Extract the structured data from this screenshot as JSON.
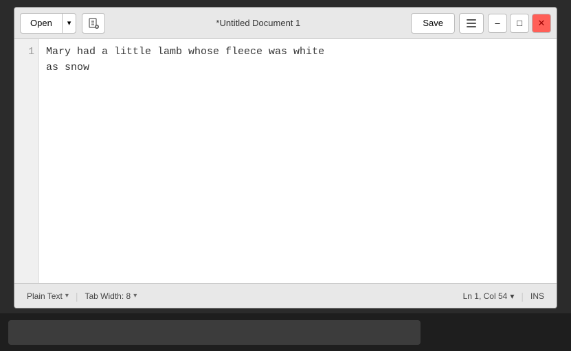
{
  "titlebar": {
    "open_label": "Open",
    "dropdown_arrow": "▾",
    "new_icon": "⊕",
    "title": "*Untitled Document 1",
    "save_label": "Save",
    "menu_icon": "≡",
    "minimize_label": "–",
    "maximize_label": "□",
    "close_label": "✕"
  },
  "editor": {
    "line_numbers": [
      "1"
    ],
    "content": "Mary had a little lamb whose fleece was white\nas snow"
  },
  "statusbar": {
    "file_type": "Plain Text",
    "tab_width": "Tab Width: 8",
    "position": "Ln 1, Col 54",
    "mode": "INS"
  }
}
